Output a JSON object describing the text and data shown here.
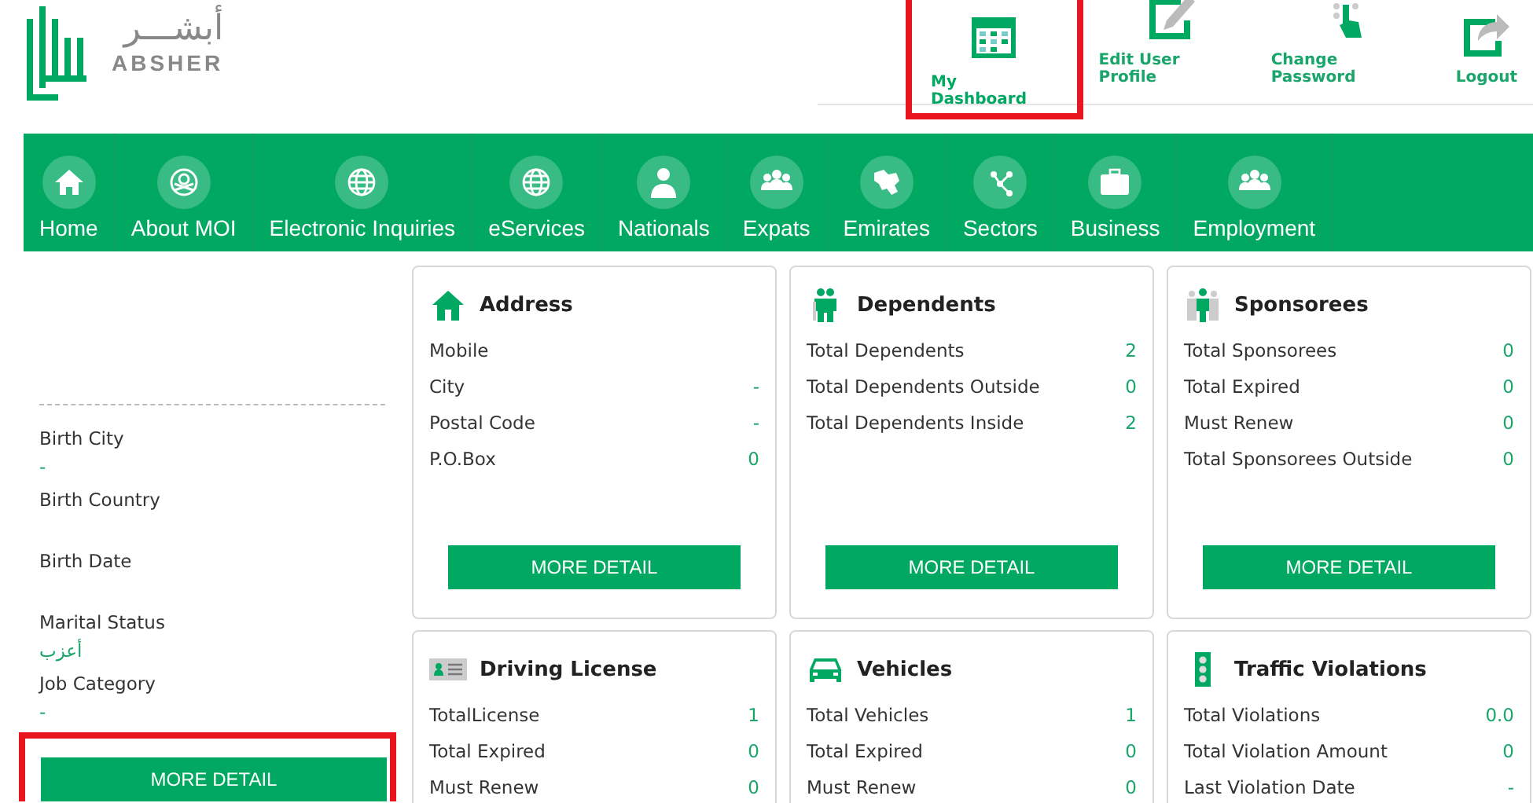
{
  "logo": {
    "arabic": "أبشـــر",
    "latin": "ABSHER"
  },
  "top_menu": [
    {
      "label": "My Dashboard",
      "selected": true,
      "highlighted": true
    },
    {
      "label": "Edit User Profile",
      "selected": false,
      "highlighted": false
    },
    {
      "label": "Change Password",
      "selected": false,
      "highlighted": false
    },
    {
      "label": "Logout",
      "selected": false,
      "highlighted": false
    }
  ],
  "nav": [
    {
      "label": "Home"
    },
    {
      "label": "About MOI"
    },
    {
      "label": "Electronic Inquiries"
    },
    {
      "label": "eServices"
    },
    {
      "label": "Nationals"
    },
    {
      "label": "Expats"
    },
    {
      "label": "Emirates"
    },
    {
      "label": "Sectors"
    },
    {
      "label": "Business"
    },
    {
      "label": "Employment"
    }
  ],
  "sidebar": {
    "fields": [
      {
        "label": "Birth City",
        "value": "-"
      },
      {
        "label": "Birth Country"
      },
      {
        "label": "Birth Date"
      },
      {
        "label": "Marital Status",
        "value": "أعزب"
      },
      {
        "label": "Job Category",
        "value": "-"
      }
    ],
    "button": {
      "label": "MORE DETAIL",
      "highlighted": true
    }
  },
  "cards": [
    {
      "kind": "address",
      "title": "Address",
      "rows": [
        {
          "label": "Mobile"
        },
        {
          "label": "City",
          "value": "-"
        },
        {
          "label": "Postal Code",
          "value": "-"
        },
        {
          "label": "P.O.Box",
          "value": "0"
        }
      ],
      "button": "MORE DETAIL"
    },
    {
      "kind": "dependents",
      "title": "Dependents",
      "rows": [
        {
          "label": "Total Dependents",
          "value": "2"
        },
        {
          "label": "Total Dependents Outside",
          "value": "0"
        },
        {
          "label": "Total Dependents Inside",
          "value": "2"
        }
      ],
      "button": "MORE DETAIL"
    },
    {
      "kind": "sponsorees",
      "title": "Sponsorees",
      "rows": [
        {
          "label": "Total Sponsorees",
          "value": "0"
        },
        {
          "label": "Total Expired",
          "value": "0"
        },
        {
          "label": "Must Renew",
          "value": "0"
        },
        {
          "label": "Total Sponsorees Outside",
          "value": "0"
        }
      ],
      "button": "MORE DETAIL"
    },
    {
      "kind": "license",
      "title": "Driving License",
      "rows": [
        {
          "label": "TotalLicense",
          "value": "1"
        },
        {
          "label": "Total Expired",
          "value": "0"
        },
        {
          "label": "Must Renew",
          "value": "0"
        }
      ]
    },
    {
      "kind": "vehicles",
      "title": "Vehicles",
      "rows": [
        {
          "label": "Total Vehicles",
          "value": "1"
        },
        {
          "label": "Total Expired",
          "value": "0"
        },
        {
          "label": "Must Renew",
          "value": "0"
        }
      ]
    },
    {
      "kind": "violations",
      "title": "Traffic Violations",
      "rows": [
        {
          "label": "Total Violations",
          "value": "0.0"
        },
        {
          "label": "Total Violation Amount",
          "value": "0"
        },
        {
          "label": "Last Violation Date",
          "value": "-"
        }
      ]
    }
  ]
}
